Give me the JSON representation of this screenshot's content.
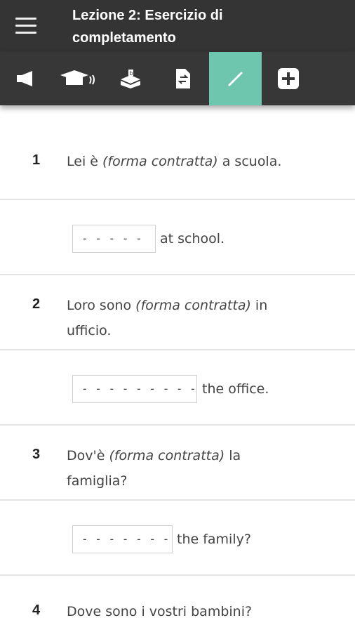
{
  "header": {
    "title_line1": "Lezione 2: Esercizio di",
    "title_line2": "completamento"
  },
  "toolbar": {
    "items": [
      {
        "icon": "megaphone-icon"
      },
      {
        "icon": "graduation-cap-icon"
      },
      {
        "icon": "learn-icon"
      },
      {
        "icon": "document-swap-icon"
      },
      {
        "icon": "pencil-icon",
        "active": true
      },
      {
        "icon": "plus-icon"
      }
    ],
    "accent_color": "#6fc6ae"
  },
  "questions": [
    {
      "number": "1",
      "prompt_before": "Lei è ",
      "prompt_hint": "(forma contratta)",
      "prompt_after": " a scuola.",
      "answer_placeholder": "- - - - -",
      "answer_suffix": "at school."
    },
    {
      "number": "2",
      "prompt_before": "Loro sono ",
      "prompt_hint": "(forma contratta)",
      "prompt_after": " in ufficio.",
      "answer_placeholder": "- - - - - - -   - -",
      "answer_suffix": "the office."
    },
    {
      "number": "3",
      "prompt_before": "Dov'è ",
      "prompt_hint": "(forma contratta)",
      "prompt_after": " la famiglia?",
      "answer_placeholder": "- - - - - - -",
      "answer_suffix": "the family?"
    },
    {
      "number": "4",
      "prompt_before": "Dove sono i vostri bambini?"
    }
  ]
}
